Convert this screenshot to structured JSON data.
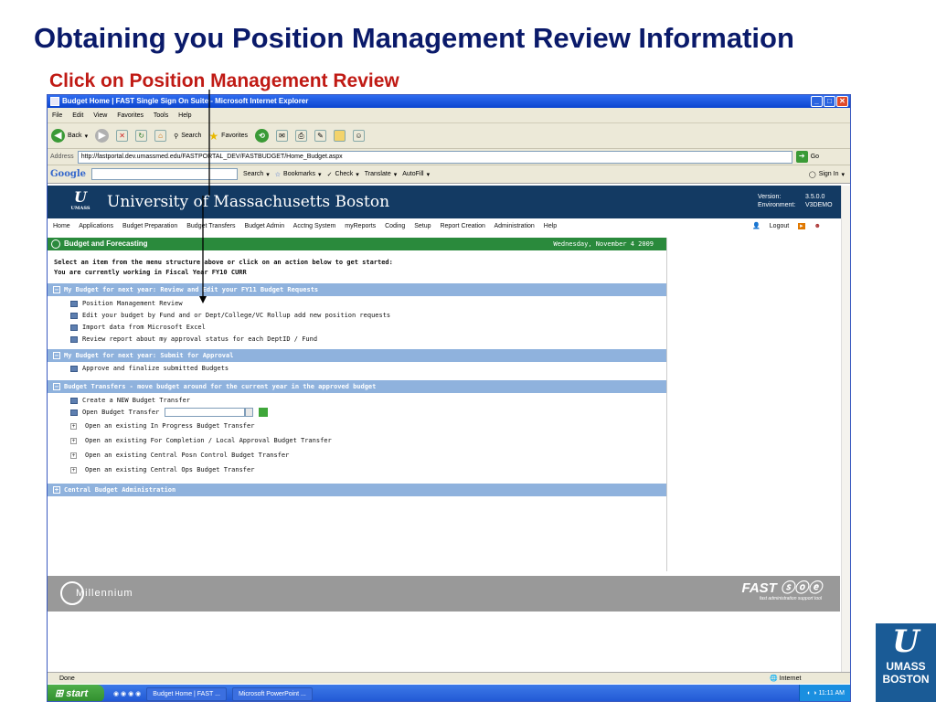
{
  "slide": {
    "title": "Obtaining you Position Management Review Information",
    "subtitle": "Click on Position Management Review",
    "logo_mark": "U",
    "logo_text_1": "UMASS",
    "logo_text_2": "BOSTON"
  },
  "browser": {
    "window_title": "Budget Home | FAST Single Sign On Suite - Microsoft Internet Explorer",
    "menu": [
      "File",
      "Edit",
      "View",
      "Favorites",
      "Tools",
      "Help"
    ],
    "toolbar": {
      "back": "Back",
      "search": "Search",
      "favorites": "Favorites"
    },
    "address_label": "Address",
    "address_url": "http://fastportal.dev.umassmed.edu/FASTPORTAL_DEV/FASTBUDGET/Home_Budget.aspx",
    "go_label": "Go",
    "google": {
      "logo": "Google",
      "search": "Search",
      "bookmarks": "Bookmarks",
      "check": "Check",
      "translate": "Translate",
      "autofill": "AutoFill",
      "signin": "Sign In"
    },
    "status_text": "Done",
    "zone_text": "Internet"
  },
  "page": {
    "university_name": "University of Massachusetts Boston",
    "version_label": "Version:",
    "version_value": "3.5.0.0",
    "environment_label": "Environment:",
    "environment_value": "V3DEMO",
    "nav": [
      "Home",
      "Applications",
      "Budget Preparation",
      "Budget Transfers",
      "Budget Admin",
      "Acctng System",
      "myReports",
      "Coding",
      "Setup",
      "Report Creation",
      "Administration",
      "Help"
    ],
    "logout": "Logout",
    "header_title": "Budget and Forecasting",
    "header_date": "Wednesday, November 4 2009",
    "intro_line1": "Select an item from the menu structure above or click on an action below to get started:",
    "intro_line2": "You are currently working in Fiscal Year FY10 CURR",
    "sections": {
      "s1": {
        "title": "My Budget for next year: Review and Edit your FY11 Budget Requests",
        "items": [
          "Position Management Review",
          "Edit your budget by Fund and or Dept/College/VC Rollup add new position requests",
          "Import data from Microsoft Excel",
          "Review report about my approval status for each DeptID / Fund"
        ]
      },
      "s2": {
        "title": "My Budget for next year: Submit for Approval",
        "items": [
          "Approve and finalize submitted Budgets"
        ]
      },
      "s3": {
        "title": "Budget Transfers - move budget around for the current year in the approved budget",
        "items": [
          "Create a NEW Budget Transfer",
          "Open Budget Transfer",
          "Open an existing In Progress Budget Transfer",
          "Open an existing For Completion / Local Approval Budget Transfer",
          "Open an existing Central Posn Control Budget Transfer",
          "Open an existing Central Ops Budget Transfer"
        ]
      },
      "s4": {
        "title": "Central Budget Administration"
      }
    },
    "footer_brand": "Millennium",
    "footer_fast": "FAST",
    "footer_fast_tagline": "fast administration support tool"
  },
  "taskbar": {
    "start": "start",
    "task1": "Budget Home | FAST ...",
    "task2": "Microsoft PowerPoint ...",
    "clock": "11:11 AM"
  },
  "colors": {
    "title": "#0a1a6a",
    "subtitle": "#c01a14",
    "banner": "#133a63",
    "green_header": "#2a8a3c",
    "section": "#8fb2dd"
  }
}
